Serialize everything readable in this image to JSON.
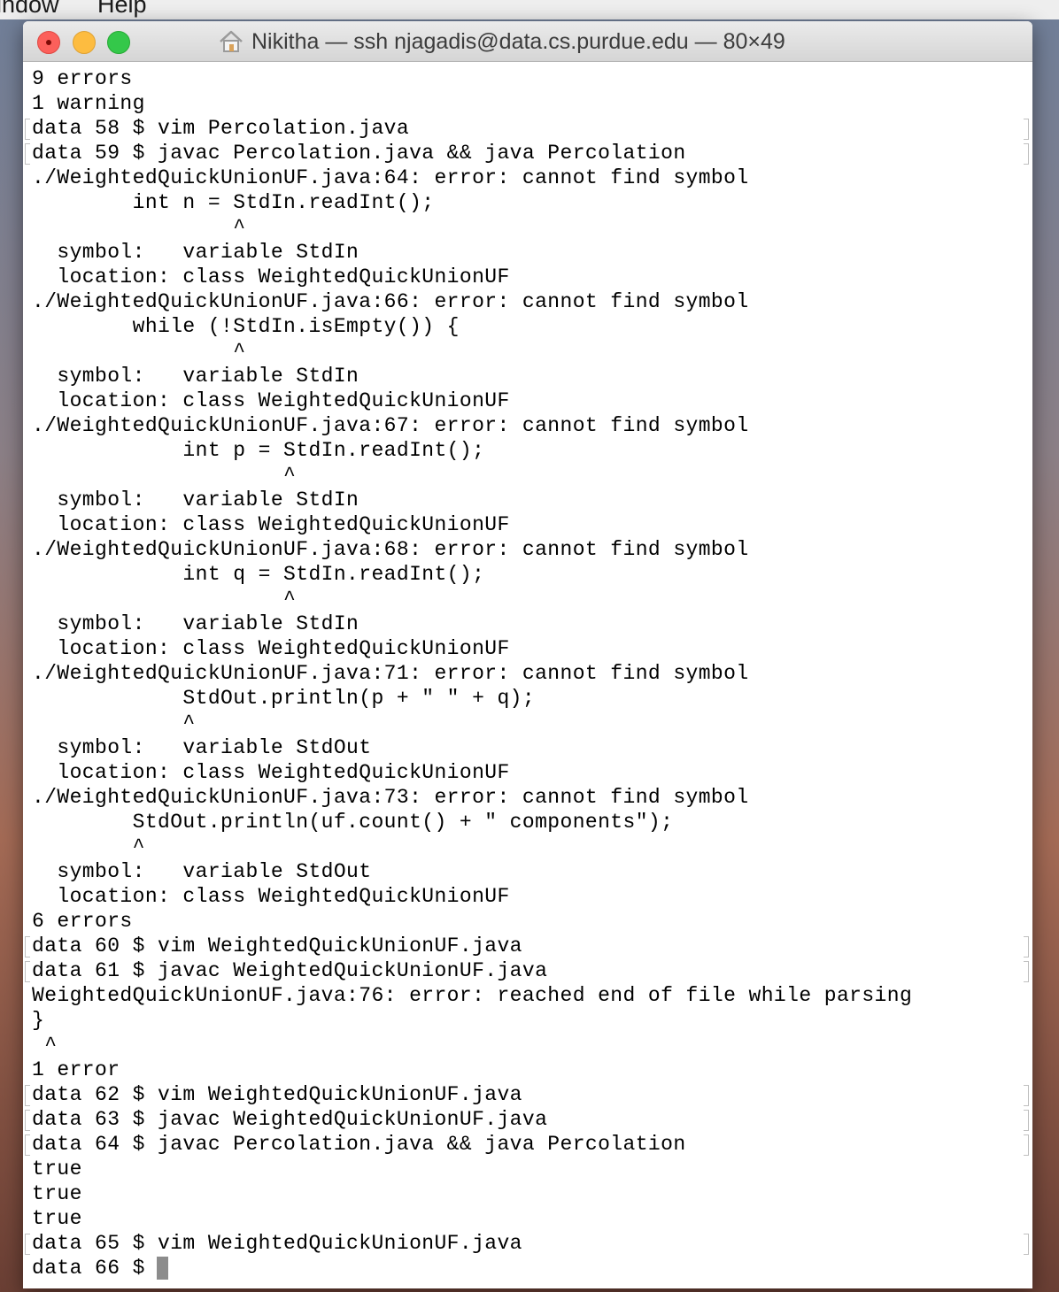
{
  "menubar": {
    "items": [
      "indow",
      "Help"
    ]
  },
  "window": {
    "title": "Nikitha — ssh njagadis@data.cs.purdue.edu — 80×49"
  },
  "terminal": {
    "lines": [
      "9 errors",
      "1 warning",
      "data 58 $ vim Percolation.java",
      "data 59 $ javac Percolation.java && java Percolation",
      "./WeightedQuickUnionUF.java:64: error: cannot find symbol",
      "        int n = StdIn.readInt();",
      "                ^",
      "  symbol:   variable StdIn",
      "  location: class WeightedQuickUnionUF",
      "./WeightedQuickUnionUF.java:66: error: cannot find symbol",
      "        while (!StdIn.isEmpty()) {",
      "                ^",
      "  symbol:   variable StdIn",
      "  location: class WeightedQuickUnionUF",
      "./WeightedQuickUnionUF.java:67: error: cannot find symbol",
      "            int p = StdIn.readInt();",
      "                    ^",
      "  symbol:   variable StdIn",
      "  location: class WeightedQuickUnionUF",
      "./WeightedQuickUnionUF.java:68: error: cannot find symbol",
      "            int q = StdIn.readInt();",
      "                    ^",
      "  symbol:   variable StdIn",
      "  location: class WeightedQuickUnionUF",
      "./WeightedQuickUnionUF.java:71: error: cannot find symbol",
      "            StdOut.println(p + \" \" + q);",
      "            ^",
      "  symbol:   variable StdOut",
      "  location: class WeightedQuickUnionUF",
      "./WeightedQuickUnionUF.java:73: error: cannot find symbol",
      "        StdOut.println(uf.count() + \" components\");",
      "        ^",
      "  symbol:   variable StdOut",
      "  location: class WeightedQuickUnionUF",
      "6 errors",
      "data 60 $ vim WeightedQuickUnionUF.java",
      "data 61 $ javac WeightedQuickUnionUF.java",
      "WeightedQuickUnionUF.java:76: error: reached end of file while parsing",
      "}",
      " ^",
      "1 error",
      "data 62 $ vim WeightedQuickUnionUF.java",
      "data 63 $ javac WeightedQuickUnionUF.java",
      "data 64 $ javac Percolation.java && java Percolation",
      "true",
      "true",
      "true",
      "data 65 $ vim WeightedQuickUnionUF.java",
      "data 66 $ "
    ]
  }
}
